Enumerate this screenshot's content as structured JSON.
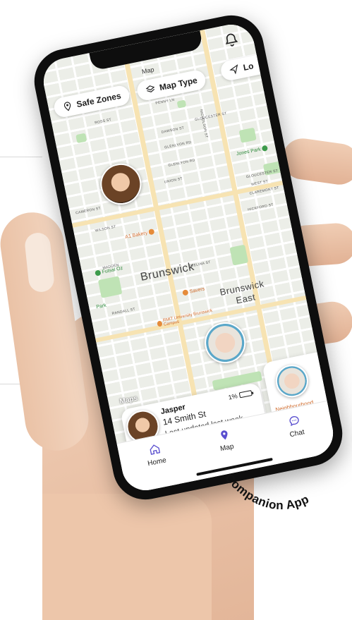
{
  "header": {
    "map_title": "Map",
    "safe_zones_label": "Safe Zones",
    "map_type_label": "Map Type",
    "locate_label": "Lo"
  },
  "map": {
    "areas": [
      {
        "label": "Brunswick"
      },
      {
        "label": "Brunswick"
      },
      {
        "label": "East"
      }
    ],
    "pois": [
      {
        "label": "A1 Bakery"
      },
      {
        "label": "Futsal Oz"
      },
      {
        "label": "Savers"
      },
      {
        "label": "RMIT University Brunswick Campus"
      },
      {
        "label": "Jones Park"
      },
      {
        "label": "Park"
      }
    ],
    "streets": [
      {
        "label": "ROSS ST"
      },
      {
        "label": "PENNY LN"
      },
      {
        "label": "GLOUCESTER ST"
      },
      {
        "label": "DAWSON ST"
      },
      {
        "label": "CAMERON ST"
      },
      {
        "label": "GLENLYON RD"
      },
      {
        "label": "UNION ST"
      },
      {
        "label": "WILSON ST"
      },
      {
        "label": "GLOUCESTER ST"
      },
      {
        "label": "WEST ST"
      },
      {
        "label": "CLAREMONT ST"
      },
      {
        "label": "HICKFORD ST"
      },
      {
        "label": "MADDEN"
      },
      {
        "label": "EVELINA ST"
      },
      {
        "label": "NICHOLSON ST"
      },
      {
        "label": "RANDALL ST"
      },
      {
        "label": "GLENLYON RD"
      }
    ],
    "google_mark": "Maps"
  },
  "card": {
    "name": "Jasper",
    "address": "14 Smith St",
    "updated": "Last updated last week",
    "battery": "1%"
  },
  "side_card": {
    "text": "Neighbourhood"
  },
  "nav": {
    "items": [
      {
        "label": "Home",
        "icon": "home-icon"
      },
      {
        "label": "Map",
        "icon": "map-pin-icon"
      },
      {
        "label": "Chat",
        "icon": "chat-icon"
      }
    ]
  },
  "caption": {
    "text": "Companion App"
  },
  "colors": {
    "accent": "#5a4fcf",
    "park": "#bfe3b5",
    "major_road": "#f7e3b2"
  }
}
